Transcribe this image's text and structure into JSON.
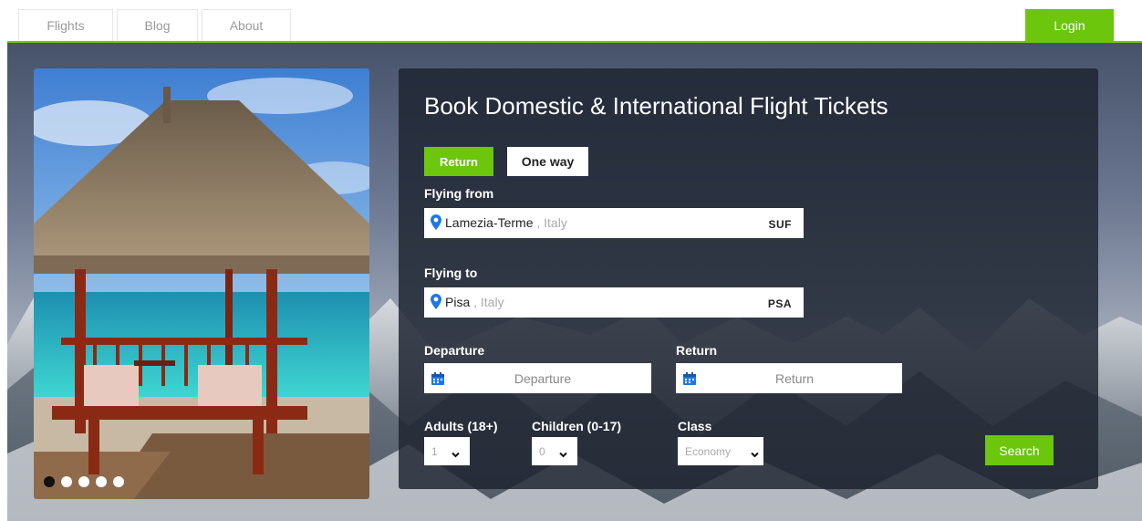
{
  "nav": {
    "tabs": [
      {
        "label": "Flights"
      },
      {
        "label": "Blog"
      },
      {
        "label": "About"
      }
    ],
    "login_label": "Login"
  },
  "carousel": {
    "slide_count": 5,
    "active_index": 0
  },
  "booking": {
    "title": "Book Domestic & International Flight Tickets",
    "trip_types": {
      "return": "Return",
      "one_way": "One way",
      "selected": "Return"
    },
    "from": {
      "label": "Flying from",
      "city": "Lamezia-Terme",
      "country": " , Italy",
      "code": "SUF"
    },
    "to": {
      "label": "Flying to",
      "city": "Pisa",
      "country": " , Italy",
      "code": "PSA"
    },
    "departure": {
      "label": "Departure",
      "placeholder": "Departure"
    },
    "return_date": {
      "label": "Return",
      "placeholder": "Return"
    },
    "adults": {
      "label": "Adults (18+)",
      "value": "1"
    },
    "children": {
      "label": "Children (0-17)",
      "value": "0"
    },
    "class": {
      "label": "Class",
      "value": "Economy"
    },
    "search_label": "Search"
  },
  "colors": {
    "accent": "#6bc60c",
    "pin": "#1e78e6",
    "panel": "#1c222e"
  },
  "icons": {
    "location": "map-pin-icon",
    "calendar": "calendar-icon",
    "dropdown": "chevron-down-icon"
  }
}
